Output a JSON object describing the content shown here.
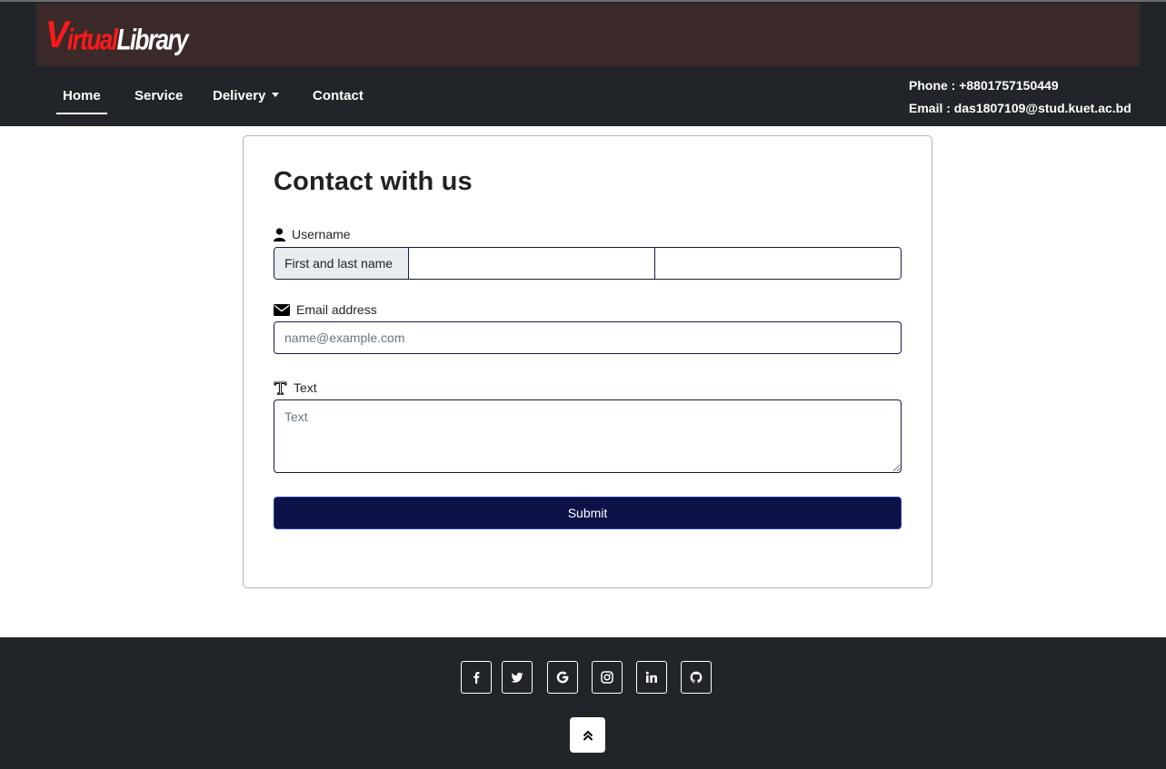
{
  "brand": {
    "logo_v": "V",
    "logo_irtual": "irtual",
    "logo_library": "Library"
  },
  "nav": {
    "home": "Home",
    "service": "Service",
    "delivery": "Delivery",
    "contact": "Contact"
  },
  "contact_info": {
    "phone": "Phone : +8801757150449",
    "email": "Email : das1807109@stud.kuet.ac.bd"
  },
  "form": {
    "title": "Contact with us",
    "username_label": "Username",
    "username_addon": "First and last name",
    "first_name_value": "",
    "last_name_value": "",
    "email_label": "Email address",
    "email_placeholder": "name@example.com",
    "text_label": "Text",
    "text_placeholder": "Text",
    "submit_label": "Submit"
  },
  "footer": {
    "social_icons": [
      "facebook-icon",
      "twitter-icon",
      "google-icon",
      "instagram-icon",
      "linkedin-icon",
      "github-icon"
    ]
  },
  "colors": {
    "navbar_bg": "#212529",
    "brand_strip_bg": "#3b2a29",
    "logo_red": "#ff1a1a",
    "submit_bg": "#0c1248",
    "input_border": "#141a4a"
  }
}
